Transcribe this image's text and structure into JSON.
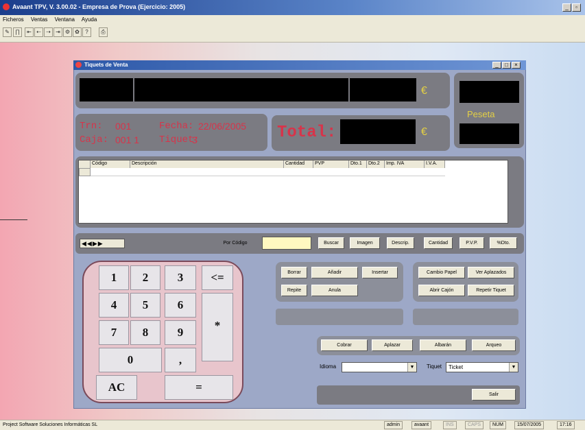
{
  "app": {
    "title": "Avaant TPV, V. 3.00.02 - Empresa de Prova (Ejercicio: 2005)",
    "menu": [
      "Ficheros",
      "Ventas",
      "Ventana",
      "Ayuda"
    ]
  },
  "child": {
    "title": "Tiquets de Venta"
  },
  "info": {
    "trn_label": "Trn:",
    "trn_value": "001",
    "fecha_label": "Fecha:",
    "fecha_value": "22/06/2005",
    "caja_label": "Caja:",
    "caja_value": "001 1",
    "tiquet_label": "Tiquet:",
    "tiquet_value": "3",
    "total_label": "Total:",
    "currency_symbol": "€",
    "peseta_label": "Peseta"
  },
  "grid": {
    "columns": [
      "Código",
      "Descripción",
      "Cantidad",
      "PVP",
      "Dto.1",
      "Dto.2",
      "Imp. IVA",
      "I.V.A."
    ]
  },
  "search": {
    "by_code_label": "Por Código",
    "buttons": [
      "Buscar",
      "Imagen",
      "Descrip.",
      "Cantidad",
      "P.V.P.",
      "%Dto."
    ]
  },
  "keypad": {
    "keys": [
      "1",
      "2",
      "3",
      "<=",
      "4",
      "5",
      "6",
      "*",
      "7",
      "8",
      "9",
      "0",
      ",",
      "AC",
      "="
    ]
  },
  "edit_buttons": [
    "Borrar",
    "Añadir",
    "Insertar",
    "Repite",
    "Anula"
  ],
  "drawer_buttons": [
    "Cambio Papel",
    "Ver Aplazados",
    "Abrir Cajón",
    "Repetir Tiquet"
  ],
  "actions": [
    "Cobrar",
    "Aplazar",
    "Albarán",
    "Arqueo"
  ],
  "idioma_label": "Idioma",
  "tiquet_label": "Tiquet",
  "tiquet_value": "Ticket",
  "salir_label": "Salir",
  "status": {
    "company": "Project Software Soluciones Informáticas SL",
    "user": "admin",
    "user2": "avaant",
    "ins": "INS",
    "caps": "CAPS",
    "num": "NUM",
    "date": "15/07/2005",
    "time": "17:16"
  }
}
